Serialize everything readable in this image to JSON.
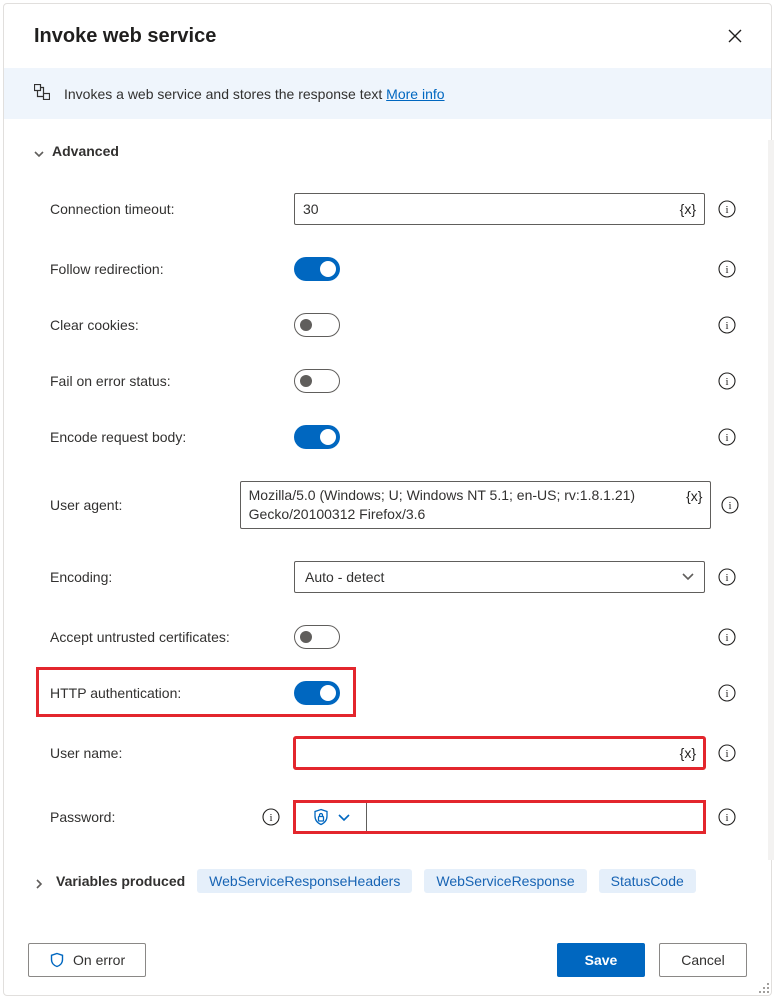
{
  "header": {
    "title": "Invoke web service"
  },
  "banner": {
    "description": "Invokes a web service and stores the response text ",
    "more_info": "More info"
  },
  "sections": {
    "advanced": {
      "label": "Advanced"
    },
    "variables_produced": {
      "label": "Variables produced"
    }
  },
  "fields": {
    "connection_timeout": {
      "label": "Connection timeout:",
      "value": "30"
    },
    "follow_redirection": {
      "label": "Follow redirection:",
      "on": true
    },
    "clear_cookies": {
      "label": "Clear cookies:",
      "on": false
    },
    "fail_on_error_status": {
      "label": "Fail on error status:",
      "on": false
    },
    "encode_request_body": {
      "label": "Encode request body:",
      "on": true
    },
    "user_agent": {
      "label": "User agent:",
      "value": "Mozilla/5.0 (Windows; U; Windows NT 5.1; en-US; rv:1.8.1.21) Gecko/20100312 Firefox/3.6"
    },
    "encoding": {
      "label": "Encoding:",
      "value": "Auto - detect"
    },
    "accept_untrusted_certificates": {
      "label": "Accept untrusted certificates:",
      "on": false
    },
    "http_authentication": {
      "label": "HTTP authentication:",
      "on": true
    },
    "user_name": {
      "label": "User name:",
      "value": ""
    },
    "password": {
      "label": "Password:",
      "value": ""
    }
  },
  "glyphs": {
    "variable": "{x}"
  },
  "variables_produced": {
    "items": [
      "WebServiceResponseHeaders",
      "WebServiceResponse",
      "StatusCode"
    ]
  },
  "footer": {
    "on_error": "On error",
    "save": "Save",
    "cancel": "Cancel"
  }
}
